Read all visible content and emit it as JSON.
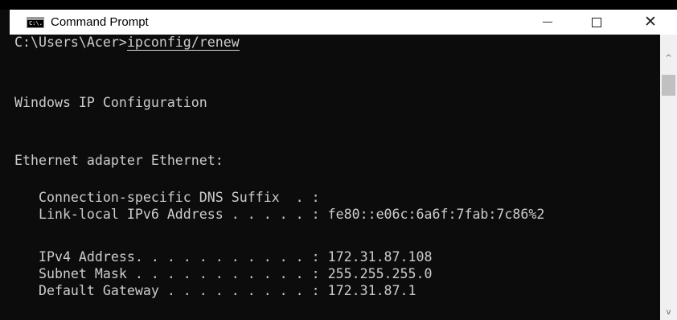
{
  "window": {
    "title": "Command Prompt",
    "icon_text": "C:\\."
  },
  "console": {
    "prompt": "C:\\Users\\Acer>",
    "command": "ipconfig/renew",
    "heading": "Windows IP Configuration",
    "adapter": "Ethernet adapter Ethernet:",
    "rows": [
      "   Connection-specific DNS Suffix  . :",
      "   Link-local IPv6 Address . . . . . : fe80::e06c:6a6f:7fab:7c86%2",
      "   IPv4 Address. . . . . . . . . . . : 172.31.87.108",
      "   Subnet Mask . . . . . . . . . . . : 255.255.255.0",
      "   Default Gateway . . . . . . . . . : 172.31.87.1"
    ]
  },
  "icons": {
    "minimize": "minimize-icon",
    "maximize": "maximize-icon",
    "close": "close-icon",
    "scroll_up": "chevron-up-icon",
    "scroll_down": "chevron-down-icon",
    "close_glyph": "✕",
    "up_glyph": "^",
    "down_glyph": "v"
  },
  "colors": {
    "console_bg": "#0c0c0c",
    "console_text": "#cccccc",
    "titlebar_bg": "#ffffff"
  }
}
